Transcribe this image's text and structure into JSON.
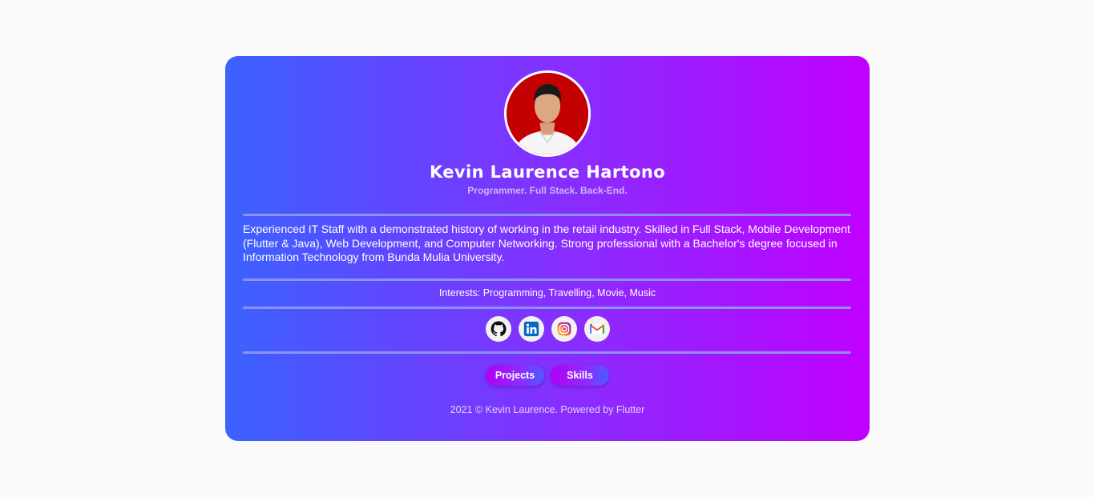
{
  "profile": {
    "name": "Kevin Laurence Hartono",
    "tagline": "Programmer. Full Stack. Back-End.",
    "about": "Experienced IT Staff with a demonstrated history of working in the retail industry. Skilled in Full Stack, Mobile Development (Flutter & Java), Web Development, and Computer Networking. Strong professional with a Bachelor's degree focused in Information Technology from Bunda Mulia University.",
    "interests": "Interests: Programming, Travelling, Movie, Music"
  },
  "socials": [
    {
      "icon": "github-icon"
    },
    {
      "icon": "linkedin-icon"
    },
    {
      "icon": "instagram-icon"
    },
    {
      "icon": "gmail-icon"
    }
  ],
  "buttons": {
    "projects": "Projects",
    "skills": "Skills"
  },
  "footer": {
    "text": "2021 © Kevin Laurence. Powered by Flutter"
  },
  "colors": {
    "page_background": "#fafafa",
    "gradient_start": "#3a63ff",
    "gradient_end": "#c000ff",
    "divider": "#8e97f7",
    "tagline": "#cdb7f2"
  }
}
